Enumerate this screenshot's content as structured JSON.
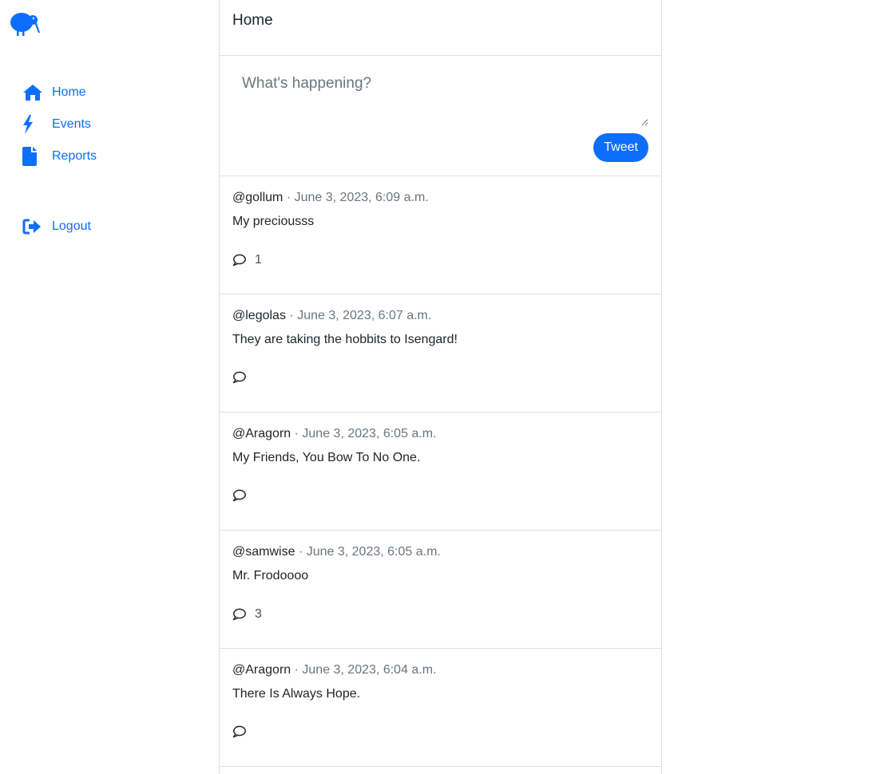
{
  "sidebar": {
    "logo_icon": "kiwi-bird-icon",
    "nav": [
      {
        "label": "Home",
        "icon": "home-icon"
      },
      {
        "label": "Events",
        "icon": "bolt-icon"
      },
      {
        "label": "Reports",
        "icon": "file-icon"
      }
    ],
    "logout": {
      "label": "Logout",
      "icon": "logout-icon"
    }
  },
  "header": {
    "title": "Home"
  },
  "composer": {
    "placeholder": "What's happening?",
    "value": "",
    "button_label": "Tweet"
  },
  "tweets": [
    {
      "user": "@gollum",
      "sep": "·",
      "time": "June 3, 2023, 6:09 a.m.",
      "text": "My preciousss",
      "comments": "1"
    },
    {
      "user": "@legolas",
      "sep": "·",
      "time": "June 3, 2023, 6:07 a.m.",
      "text": "They are taking the hobbits to Isengard!",
      "comments": ""
    },
    {
      "user": "@Aragorn",
      "sep": "·",
      "time": "June 3, 2023, 6:05 a.m.",
      "text": "My Friends, You Bow To No One.",
      "comments": ""
    },
    {
      "user": "@samwise",
      "sep": "·",
      "time": "June 3, 2023, 6:05 a.m.",
      "text": "Mr. Frodoooo",
      "comments": "3"
    },
    {
      "user": "@Aragorn",
      "sep": "·",
      "time": "June 3, 2023, 6:04 a.m.",
      "text": "There Is Always Hope.",
      "comments": ""
    }
  ],
  "colors": {
    "accent": "#0d6efd",
    "border": "#dee2e6",
    "muted": "#6c757d"
  }
}
